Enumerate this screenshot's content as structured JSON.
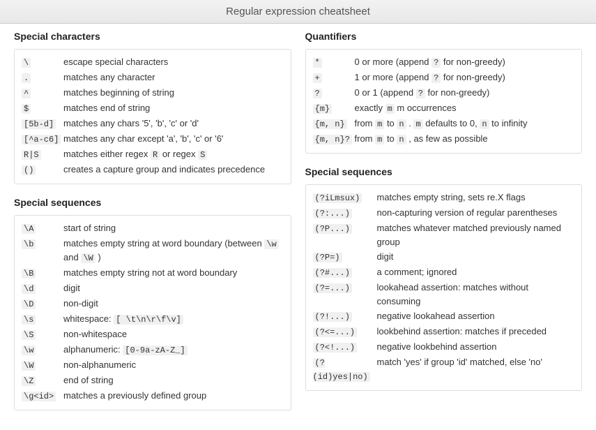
{
  "title": "Regular expression cheatsheet",
  "sections": {
    "special_chars": {
      "title": "Special characters",
      "rows": [
        {
          "pattern": "\\",
          "desc_fragments": [
            {
              "t": "text",
              "v": "escape special characters"
            }
          ]
        },
        {
          "pattern": ".",
          "desc_fragments": [
            {
              "t": "text",
              "v": "matches any character"
            }
          ]
        },
        {
          "pattern": "^",
          "desc_fragments": [
            {
              "t": "text",
              "v": "matches beginning of string"
            }
          ]
        },
        {
          "pattern": "$",
          "desc_fragments": [
            {
              "t": "text",
              "v": "matches end of string"
            }
          ]
        },
        {
          "pattern": "[5b-d]",
          "desc_fragments": [
            {
              "t": "text",
              "v": "matches any chars '5', 'b', 'c' or 'd'"
            }
          ]
        },
        {
          "pattern": "[^a-c6]",
          "desc_fragments": [
            {
              "t": "text",
              "v": "matches any char except 'a', 'b', 'c' or '6'"
            }
          ]
        },
        {
          "pattern": "R|S",
          "desc_fragments": [
            {
              "t": "text",
              "v": "matches either regex "
            },
            {
              "t": "code",
              "v": "R"
            },
            {
              "t": "text",
              "v": " or regex "
            },
            {
              "t": "code",
              "v": "S"
            }
          ]
        },
        {
          "pattern": "()",
          "desc_fragments": [
            {
              "t": "text",
              "v": "creates a capture group and indicates precedence"
            }
          ]
        }
      ]
    },
    "quantifiers": {
      "title": "Quantifiers",
      "rows": [
        {
          "pattern": "*",
          "desc_fragments": [
            {
              "t": "text",
              "v": "0 or more (append "
            },
            {
              "t": "code",
              "v": "?"
            },
            {
              "t": "text",
              "v": " for non-greedy)"
            }
          ]
        },
        {
          "pattern": "+",
          "desc_fragments": [
            {
              "t": "text",
              "v": "1 or more (append "
            },
            {
              "t": "code",
              "v": "?"
            },
            {
              "t": "text",
              "v": " for non-greedy)"
            }
          ]
        },
        {
          "pattern": "?",
          "desc_fragments": [
            {
              "t": "text",
              "v": "0 or 1 (append "
            },
            {
              "t": "code",
              "v": "?"
            },
            {
              "t": "text",
              "v": " for non-greedy)"
            }
          ]
        },
        {
          "pattern": "{m}",
          "desc_fragments": [
            {
              "t": "text",
              "v": "exactly "
            },
            {
              "t": "code",
              "v": "m"
            },
            {
              "t": "text",
              "v": " m occurrences"
            }
          ]
        },
        {
          "pattern": "{m, n}",
          "desc_fragments": [
            {
              "t": "text",
              "v": "from "
            },
            {
              "t": "code",
              "v": "m"
            },
            {
              "t": "text",
              "v": " to "
            },
            {
              "t": "code",
              "v": "n"
            },
            {
              "t": "text",
              "v": " . "
            },
            {
              "t": "code",
              "v": "m"
            },
            {
              "t": "text",
              "v": " defaults to 0, "
            },
            {
              "t": "code",
              "v": "n"
            },
            {
              "t": "text",
              "v": " to infinity"
            }
          ]
        },
        {
          "pattern": "{m, n}?",
          "desc_fragments": [
            {
              "t": "text",
              "v": "from "
            },
            {
              "t": "code",
              "v": "m"
            },
            {
              "t": "text",
              "v": " to "
            },
            {
              "t": "code",
              "v": "n"
            },
            {
              "t": "text",
              "v": " , as few as possible"
            }
          ]
        }
      ]
    },
    "special_seq_left": {
      "title": "Special sequences",
      "rows": [
        {
          "pattern": "\\A",
          "desc_fragments": [
            {
              "t": "text",
              "v": "start of string"
            }
          ]
        },
        {
          "pattern": "\\b",
          "desc_fragments": [
            {
              "t": "text",
              "v": "matches empty string at word boundary (between "
            },
            {
              "t": "code",
              "v": "\\w"
            },
            {
              "t": "text",
              "v": " and "
            },
            {
              "t": "code",
              "v": "\\W"
            },
            {
              "t": "text",
              "v": " )"
            }
          ]
        },
        {
          "pattern": "\\B",
          "desc_fragments": [
            {
              "t": "text",
              "v": "matches empty string not at word boundary"
            }
          ]
        },
        {
          "pattern": "\\d",
          "desc_fragments": [
            {
              "t": "text",
              "v": "digit"
            }
          ]
        },
        {
          "pattern": "\\D",
          "desc_fragments": [
            {
              "t": "text",
              "v": "non-digit"
            }
          ]
        },
        {
          "pattern": "\\s",
          "desc_fragments": [
            {
              "t": "text",
              "v": "whitespace: "
            },
            {
              "t": "code",
              "v": "[ \\t\\n\\r\\f\\v]"
            }
          ]
        },
        {
          "pattern": "\\S",
          "desc_fragments": [
            {
              "t": "text",
              "v": "non-whitespace"
            }
          ]
        },
        {
          "pattern": "\\w",
          "desc_fragments": [
            {
              "t": "text",
              "v": "alphanumeric: "
            },
            {
              "t": "code",
              "v": "[0-9a-zA-Z_]"
            }
          ]
        },
        {
          "pattern": "\\W",
          "desc_fragments": [
            {
              "t": "text",
              "v": "non-alphanumeric"
            }
          ]
        },
        {
          "pattern": "\\Z",
          "desc_fragments": [
            {
              "t": "text",
              "v": "end of string"
            }
          ]
        },
        {
          "pattern": "\\g<id>",
          "desc_fragments": [
            {
              "t": "text",
              "v": "matches a previously defined group"
            }
          ]
        }
      ]
    },
    "special_seq_right": {
      "title": "Special sequences",
      "rows": [
        {
          "pattern": "(?iLmsux)",
          "desc_fragments": [
            {
              "t": "text",
              "v": "matches empty string, sets re.X flags"
            }
          ]
        },
        {
          "pattern": "(?:...)",
          "desc_fragments": [
            {
              "t": "text",
              "v": "non-capturing version of regular parentheses"
            }
          ]
        },
        {
          "pattern": "(?P...)",
          "desc_fragments": [
            {
              "t": "text",
              "v": "matches whatever matched previously named group"
            }
          ]
        },
        {
          "pattern": "(?P=)",
          "desc_fragments": [
            {
              "t": "text",
              "v": "digit"
            }
          ]
        },
        {
          "pattern": "(?#...)",
          "desc_fragments": [
            {
              "t": "text",
              "v": "a comment; ignored"
            }
          ]
        },
        {
          "pattern": "(?=...)",
          "desc_fragments": [
            {
              "t": "text",
              "v": "lookahead assertion: matches without consuming"
            }
          ]
        },
        {
          "pattern": "(?!...)",
          "desc_fragments": [
            {
              "t": "text",
              "v": "negative lookahead assertion"
            }
          ]
        },
        {
          "pattern": "(?<=...)",
          "desc_fragments": [
            {
              "t": "text",
              "v": "lookbehind assertion: matches if preceded"
            }
          ]
        },
        {
          "pattern": "(?<!...)",
          "desc_fragments": [
            {
              "t": "text",
              "v": "negative lookbehind assertion"
            }
          ]
        },
        {
          "pattern": "(?(id)yes|no)",
          "desc_fragments": [
            {
              "t": "text",
              "v": "match 'yes' if group 'id' matched, else 'no'"
            }
          ]
        }
      ]
    }
  }
}
